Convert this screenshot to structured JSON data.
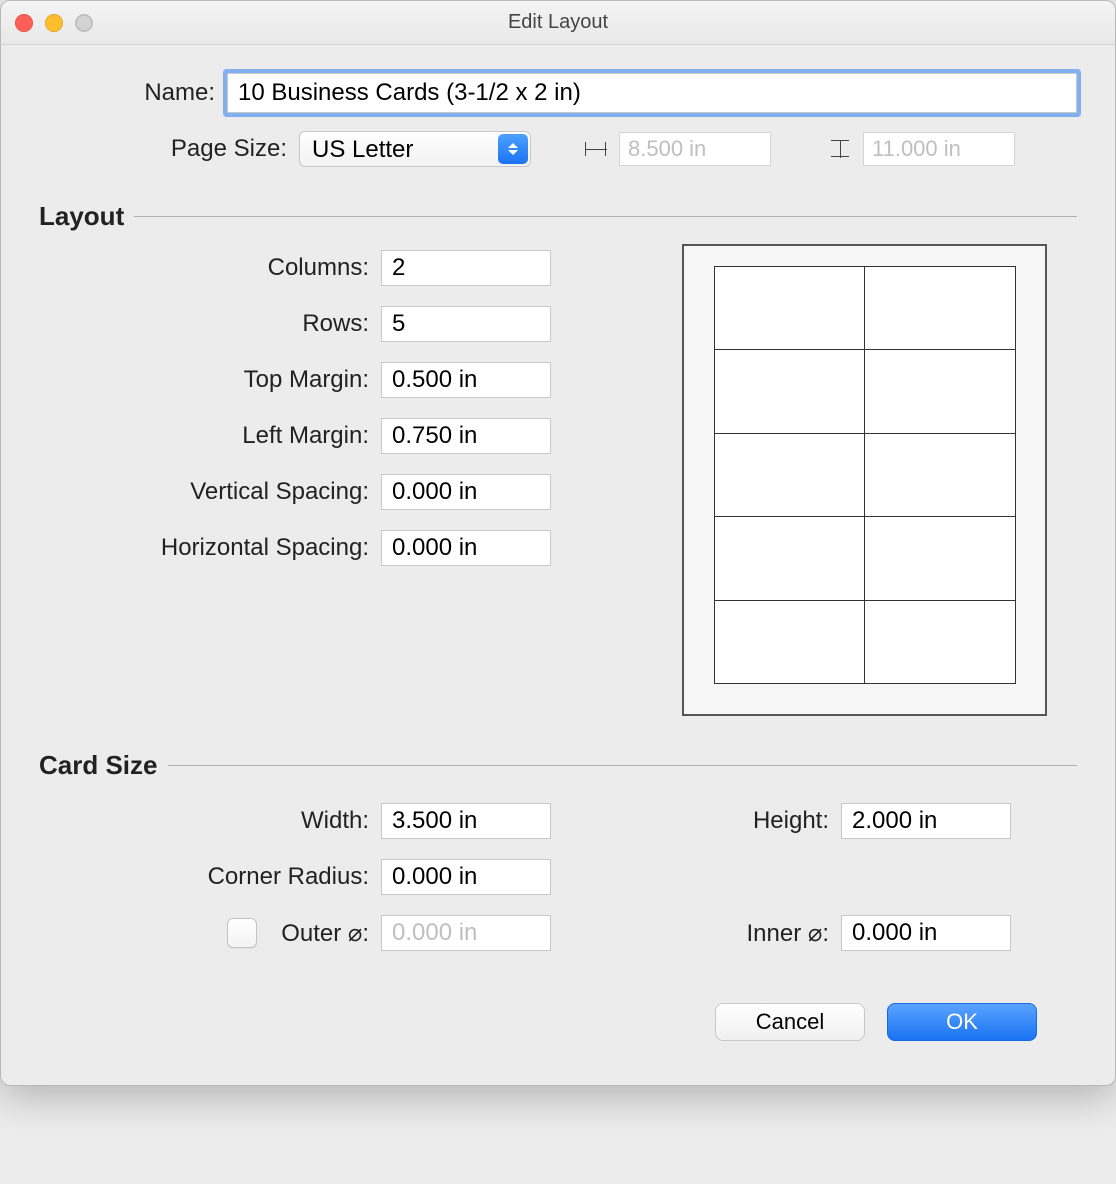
{
  "window": {
    "title": "Edit Layout"
  },
  "labels": {
    "name": "Name:",
    "page_size": "Page Size:",
    "layout_section": "Layout",
    "columns": "Columns:",
    "rows": "Rows:",
    "top_margin": "Top Margin:",
    "left_margin": "Left Margin:",
    "vertical_spacing": "Vertical Spacing:",
    "horizontal_spacing": "Horizontal Spacing:",
    "card_size_section": "Card Size",
    "width": "Width:",
    "height": "Height:",
    "corner_radius": "Corner Radius:",
    "outer_diameter": "Outer ⌀:",
    "inner_diameter": "Inner ⌀:"
  },
  "values": {
    "name": "10 Business Cards (3-1/2 x 2 in)",
    "page_size": "US Letter",
    "page_width": "8.500 in",
    "page_height": "11.000 in",
    "columns": "2",
    "rows": "5",
    "top_margin": "0.500 in",
    "left_margin": "0.750 in",
    "vertical_spacing": "0.000 in",
    "horizontal_spacing": "0.000 in",
    "card_width": "3.500 in",
    "card_height": "2.000 in",
    "corner_radius": "0.000 in",
    "outer_diameter": "0.000 in",
    "inner_diameter": "0.000 in",
    "outer_enabled": false
  },
  "preview": {
    "cols": 2,
    "rows": 5
  },
  "buttons": {
    "cancel": "Cancel",
    "ok": "OK"
  }
}
